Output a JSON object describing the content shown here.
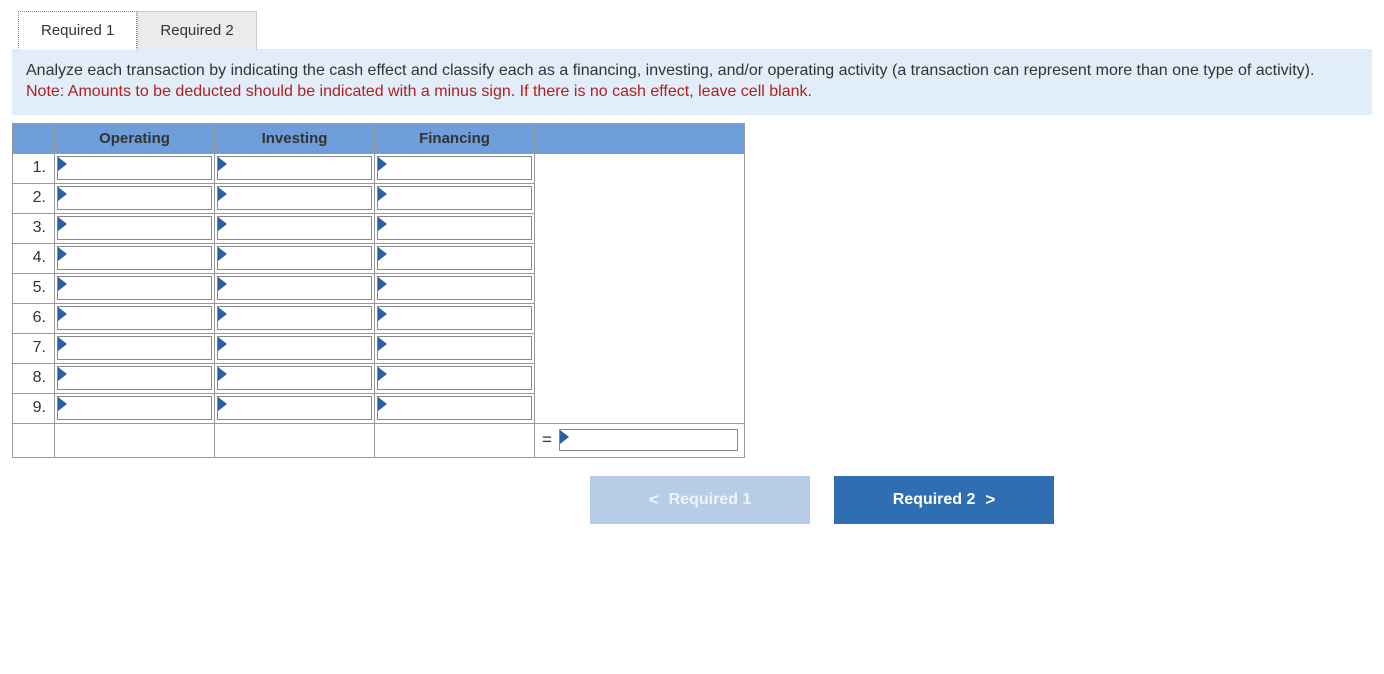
{
  "tabs": {
    "tab1": "Required 1",
    "tab2": "Required 2"
  },
  "instructions": {
    "text": "Analyze each transaction by indicating the cash effect and classify each as a financing, investing, and/or operating activity (a transaction can represent more than one type of activity).",
    "note": "Note: Amounts to be deducted should be indicated with a minus sign. If there is no cash effect, leave cell blank."
  },
  "table": {
    "headers": {
      "operating": "Operating",
      "investing": "Investing",
      "financing": "Financing"
    },
    "rows": [
      {
        "num": "1."
      },
      {
        "num": "2."
      },
      {
        "num": "3."
      },
      {
        "num": "4."
      },
      {
        "num": "5."
      },
      {
        "num": "6."
      },
      {
        "num": "7."
      },
      {
        "num": "8."
      },
      {
        "num": "9."
      }
    ],
    "equals": "="
  },
  "nav": {
    "prev": "Required 1",
    "next": "Required 2"
  }
}
